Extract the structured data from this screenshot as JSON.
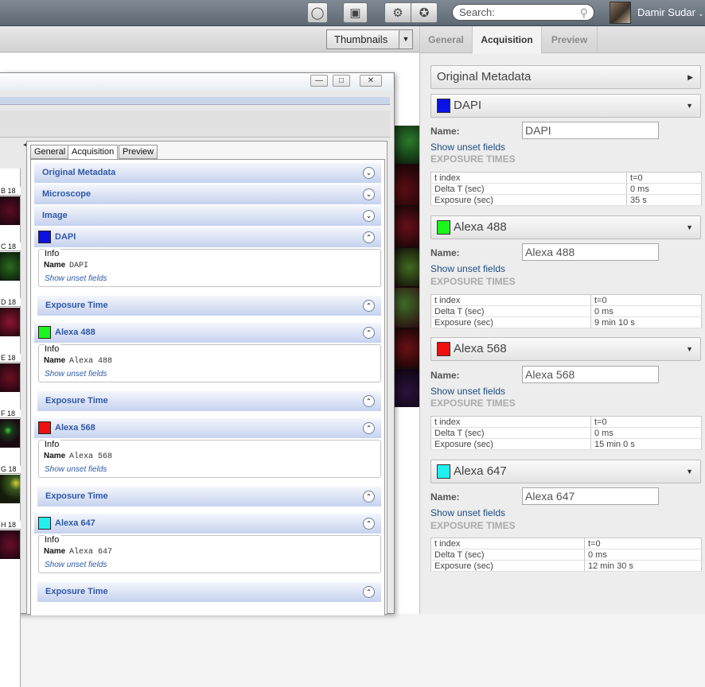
{
  "topbar": {
    "search_placeholder": "Search:",
    "user_name": "Damir Sudar",
    "buttons": [
      "lightbulb-icon",
      "basket-icon",
      "settings-icon",
      "star-icon"
    ]
  },
  "toolbar": {
    "view_mode": "Thumbnails"
  },
  "right_panel": {
    "tabs": [
      "General",
      "Acquisition",
      "Preview"
    ],
    "active_tab": "Acquisition",
    "original_metadata_label": "Original Metadata",
    "name_label": "Name:",
    "show_unset_label": "Show unset fields",
    "exposure_times_label": "EXPOSURE TIMES",
    "channels": [
      {
        "title": "DAPI",
        "color": "#0a12e6",
        "name_value": "DAPI",
        "rows": [
          [
            "t index",
            "t=0"
          ],
          [
            "Delta T (sec)",
            "0 ms"
          ],
          [
            "Exposure (sec)",
            "35 s"
          ]
        ]
      },
      {
        "title": "Alexa 488",
        "color": "#1bf51b",
        "name_value": "Alexa 488",
        "rows": [
          [
            "t index",
            "t=0"
          ],
          [
            "Delta T (sec)",
            "0 ms"
          ],
          [
            "Exposure (sec)",
            "9 min 10 s"
          ]
        ]
      },
      {
        "title": "Alexa 568",
        "color": "#f01010",
        "name_value": "Alexa 568",
        "rows": [
          [
            "t index",
            "t=0"
          ],
          [
            "Delta T (sec)",
            "0 ms"
          ],
          [
            "Exposure (sec)",
            "15 min 0 s"
          ]
        ]
      },
      {
        "title": "Alexa 647",
        "color": "#20f0f0",
        "name_value": "Alexa 647",
        "rows": [
          [
            "t index",
            "t=0"
          ],
          [
            "Delta T (sec)",
            "0 ms"
          ],
          [
            "Exposure (sec)",
            "12 min 30 s"
          ]
        ]
      }
    ]
  },
  "dialog": {
    "window_buttons": [
      "minimize-icon",
      "maximize-icon",
      "close-icon"
    ],
    "tabs": [
      "General",
      "Acquisition",
      "Preview"
    ],
    "active_tab": "Acquisition",
    "sections": [
      "Original Metadata",
      "Microscope",
      "Image"
    ],
    "info_label": "Info",
    "name_label": "Name",
    "show_unset_label": "Show unset fields",
    "exposure_time_label": "Exposure Time",
    "channels": [
      {
        "title": "DAPI",
        "color": "#0a12e6",
        "name_value": "DAPI"
      },
      {
        "title": "Alexa 488",
        "color": "#1bf51b",
        "name_value": "Alexa 488"
      },
      {
        "title": "Alexa 568",
        "color": "#f01010",
        "name_value": "Alexa 568"
      },
      {
        "title": "Alexa 647",
        "color": "#20f0f0",
        "name_value": "Alexa 647"
      }
    ],
    "thumbnail_labels": [
      "B 18",
      "C 18",
      "D 18",
      "E 18",
      "F 18",
      "G 18",
      "H 18"
    ]
  }
}
